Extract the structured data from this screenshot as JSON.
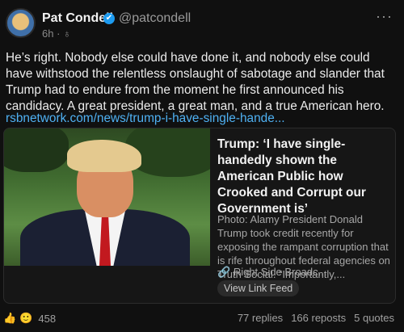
{
  "author": {
    "name": "Pat Condell",
    "handle": "@patcondell",
    "verified_mark": "✔",
    "time": "6h",
    "visibility_icon": "public-icon"
  },
  "menu": {
    "more": "···"
  },
  "post": {
    "text": "He’s right. Nobody else could have done it, and nobody else could have withstood the relentless onslaught of sabotage and slander that Trump had to endure from the moment he first announced his candidacy. A great president, a great man, and a true American hero.",
    "link": "rsbnetwork.com/news/trump-i-have-single-hande..."
  },
  "card": {
    "title": "Trump: ‘I have single-handedly shown the American Public how Crooked and Corrupt our Government is’",
    "description": "Photo: Alamy President Donald Trump took credit recently for exposing the rampant corruption that is rife throughout federal agencies on Truth Social. “Importantly,...",
    "source": "Right Side Broadc...",
    "button": "View Link Feed"
  },
  "engagement": {
    "reaction_count": "458",
    "replies": "77 replies",
    "reposts": "166 reposts",
    "quotes": "5 quotes"
  },
  "colors": {
    "background": "#101010",
    "link": "#4fb1f3",
    "verified": "#1d9bf0"
  }
}
